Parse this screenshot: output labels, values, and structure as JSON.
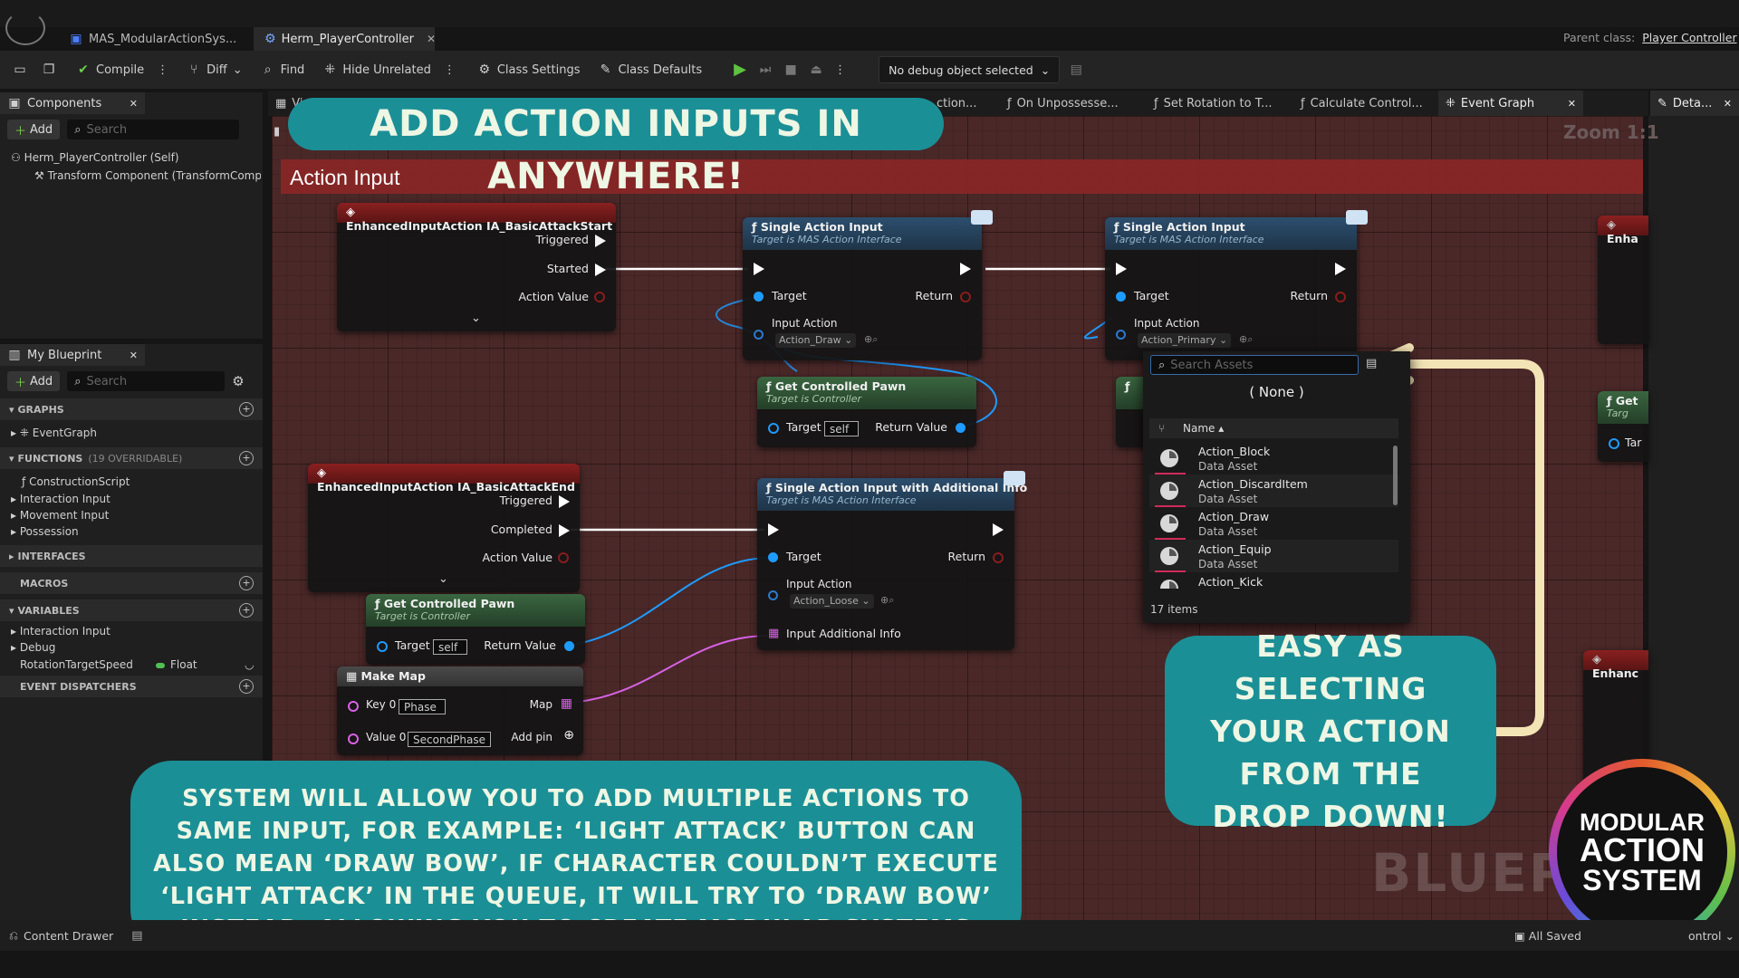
{
  "window": {
    "tabs": [
      {
        "label": "MAS_ModularActionSys..."
      },
      {
        "label": "Herm_PlayerController",
        "active": true
      }
    ],
    "parent_class_label": "Parent class:",
    "parent_class_value": "Player Controller"
  },
  "toolbar": {
    "compile": "Compile",
    "diff": "Diff",
    "find": "Find",
    "hide_unrelated": "Hide Unrelated",
    "class_settings": "Class Settings",
    "class_defaults": "Class Defaults",
    "debug_object": "No debug object selected"
  },
  "components_panel": {
    "title": "Components",
    "add": "Add",
    "search_placeholder": "Search",
    "items": [
      "Herm_PlayerController (Self)",
      "Transform Component (TransformComp"
    ]
  },
  "my_blueprint": {
    "title": "My Blueprint",
    "add": "Add",
    "search_placeholder": "Search",
    "graphs_header": "GRAPHS",
    "graph_items": [
      "EventGraph"
    ],
    "functions_header": "FUNCTIONS",
    "functions_count": "(19 OVERRIDABLE)",
    "function_items": [
      "ConstructionScript",
      "Interaction Input",
      "Movement Input",
      "Possession"
    ],
    "interfaces_header": "INTERFACES",
    "macros_header": "MACROS",
    "variables_header": "VARIABLES",
    "variable_items": [
      "Interaction Input",
      "Debug"
    ],
    "variable_name": "RotationTargetSpeed",
    "variable_type": "Float",
    "event_dispatchers_header": "EVENT DISPATCHERS"
  },
  "graph_tabs": {
    "first": "Vi",
    "items": [
      "ction...",
      "On Unpossesse...",
      "Set Rotation to T...",
      "Calculate Control...",
      "Event Graph"
    ],
    "details": "Deta..."
  },
  "graph": {
    "zoom": "Zoom 1:1",
    "comment_title": "Action Input",
    "watermark": "BLUEPR",
    "nodes": {
      "start_event": {
        "title": "EnhancedInputAction IA_BasicAttackStart",
        "triggered": "Triggered",
        "started": "Started",
        "action_value": "Action Value"
      },
      "single1": {
        "title": "Single Action Input",
        "subtitle": "Target is MAS Action Interface",
        "target": "Target",
        "return": "Return",
        "input_action": "Input Action",
        "value": "Action_Draw"
      },
      "single2": {
        "title": "Single Action Input",
        "subtitle": "Target is MAS Action Interface",
        "target": "Target",
        "return": "Return",
        "input_action": "Input Action",
        "value": "Action_Primary"
      },
      "pawn1": {
        "title": "Get Controlled Pawn",
        "subtitle": "Target is Controller",
        "target": "Target",
        "self": "self",
        "return_value": "Return Value"
      },
      "end_event": {
        "title": "EnhancedInputAction IA_BasicAttackEnd",
        "triggered": "Triggered",
        "completed": "Completed",
        "action_value": "Action Value"
      },
      "single_info": {
        "title": "Single Action Input with Additional Info",
        "subtitle": "Target is MAS Action Interface",
        "target": "Target",
        "return": "Return",
        "input_action": "Input Action",
        "value": "Action_Loose",
        "additional": "Input Additional Info"
      },
      "pawn2": {
        "title": "Get Controlled Pawn",
        "subtitle": "Target is Controller",
        "target": "Target",
        "self": "self",
        "return_value": "Return Value"
      },
      "make_map": {
        "title": "Make Map",
        "key0": "Key 0",
        "key0_value": "Phase",
        "map": "Map",
        "value0": "Value 0",
        "value0_value": "SecondPhase",
        "add_pin": "Add pin"
      },
      "right_partials": [
        "Enha",
        "Get",
        "Targ",
        "Tar",
        "Enhanc"
      ]
    }
  },
  "dropdown": {
    "search_placeholder": "Search Assets",
    "none": "( None )",
    "column": "Name",
    "items": [
      {
        "name": "Action_Block",
        "type": "Data Asset"
      },
      {
        "name": "Action_DiscardItem",
        "type": "Data Asset"
      },
      {
        "name": "Action_Draw",
        "type": "Data Asset"
      },
      {
        "name": "Action_Equip",
        "type": "Data Asset"
      },
      {
        "name": "Action_Kick",
        "type": "Data Asset"
      }
    ],
    "count": "17 items"
  },
  "banners": {
    "top": "ADD ACTION INPUTS IN ANYWHERE!",
    "right": "EASY AS SELECTING YOUR ACTION FROM THE DROP DOWN!",
    "bottom": "SYSTEM WILL ALLOW YOU TO ADD MULTIPLE ACTIONS TO SAME INPUT, FOR EXAMPLE: ‘LIGHT ATTACK’ BUTTON CAN ALSO MEAN ‘DRAW BOW’, IF CHARACTER COULDN’T EXECUTE ‘LIGHT ATTACK’ IN THE QUEUE, IT WILL TRY TO ‘DRAW BOW’ INSTEAD, ALLOWING YOU TO CREATE MODULAR SYSTEMS"
  },
  "logo": {
    "line1": "MODULAR",
    "line2": "ACTION",
    "line3": "SYSTEM"
  },
  "statusbar": {
    "content_drawer": "Content Drawer",
    "all_saved": "All Saved",
    "control": "ontrol"
  },
  "colors": {
    "accent_teal": "#1b8f96",
    "comment_red": "#8a2626",
    "arrow_cream": "#f3e4b6",
    "pin_blue": "#1e9bff",
    "pin_pink": "#d862e6"
  }
}
